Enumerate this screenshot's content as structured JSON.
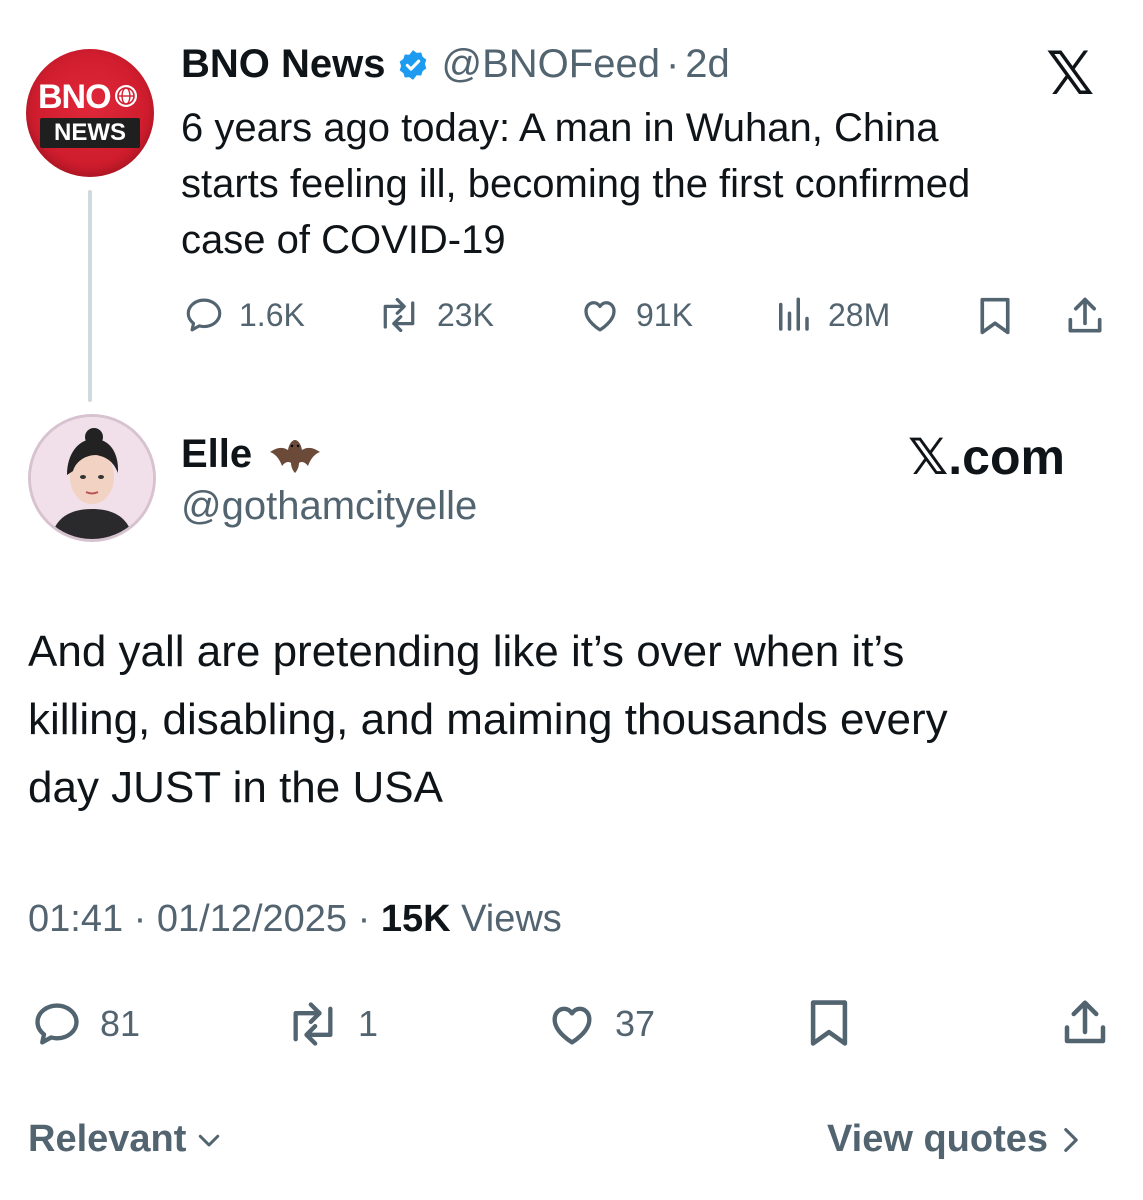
{
  "parent_tweet": {
    "avatar_text_line1": "BNO",
    "avatar_text_line2": "NEWS",
    "name": "BNO News",
    "handle": "@BNOFeed",
    "separator": "·",
    "time": "2d",
    "text_lines": [
      "6 years ago today: A man in Wuhan, China",
      "starts feeling ill, becoming the first confirmed",
      "case of COVID-19"
    ],
    "stats": {
      "replies": "1.6K",
      "reposts": "23K",
      "likes": "91K",
      "views": "28M"
    },
    "verified_color": "#1d9bf0"
  },
  "reply_tweet": {
    "name": "Elle",
    "handle": "@gothamcityelle",
    "emoji": "bat-emoji",
    "watermark": "𝕏.com",
    "text_lines": [
      "And yall are pretending like it’s over when it’s",
      "killing, disabling, and maiming thousands every",
      "day JUST in the USA"
    ],
    "time": "01:41",
    "sep1": "·",
    "date": "01/12/2025",
    "sep2": "·",
    "views_count": "15K",
    "views_label": "Views",
    "stats": {
      "replies": "81",
      "reposts": "1",
      "likes": "37"
    }
  },
  "footer": {
    "sort_label": "Relevant",
    "view_quotes_label": "View quotes"
  },
  "x_logo": "𝕏",
  "colors": {
    "text": "#0f1419",
    "muted": "#536471",
    "bno_red": "#d21f30",
    "thread_line": "#cfd9de"
  }
}
